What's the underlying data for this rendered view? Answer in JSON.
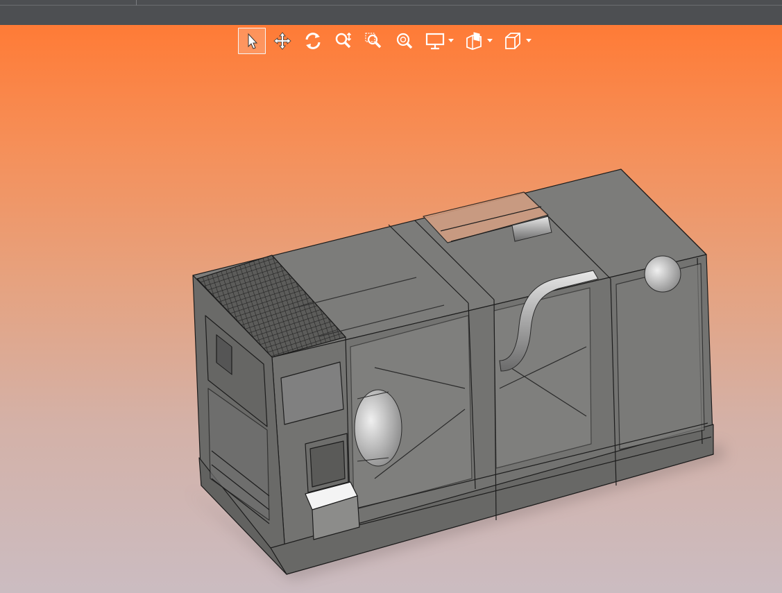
{
  "toolbar": {
    "tools": [
      {
        "icon": "select-arrow-icon",
        "active": true
      },
      {
        "icon": "pan-icon",
        "active": false
      },
      {
        "icon": "rotate-icon",
        "active": false
      },
      {
        "icon": "zoom-in-out-icon",
        "active": false
      },
      {
        "icon": "zoom-window-icon",
        "active": false
      },
      {
        "icon": "zoom-fit-icon",
        "active": false
      },
      {
        "icon": "display-mode-icon",
        "active": false,
        "dropdown": true
      },
      {
        "icon": "section-view-icon",
        "active": false,
        "dropdown": true
      },
      {
        "icon": "view-cube-icon",
        "active": false,
        "dropdown": true
      }
    ]
  },
  "viewport": {
    "model": "generator-enclosure-3d",
    "colors": {
      "background_top": "#ff7b36",
      "background_bottom": "#cbbcc1",
      "model_fill": "#7a7a78",
      "model_edge": "#1e1e1e"
    }
  }
}
